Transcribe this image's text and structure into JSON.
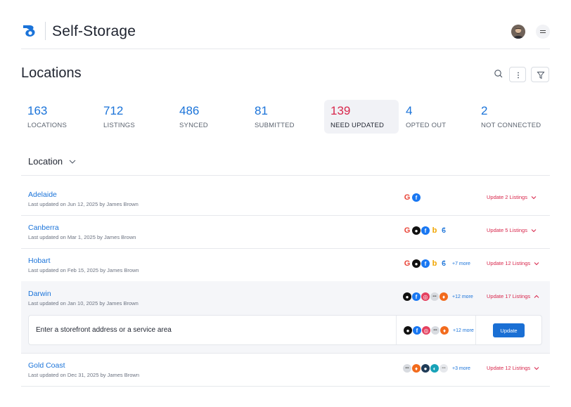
{
  "header": {
    "brand": "Self-Storage"
  },
  "page": {
    "title": "Locations"
  },
  "stats": [
    {
      "value": "163",
      "label": "LOCATIONS"
    },
    {
      "value": "712",
      "label": "LISTINGS"
    },
    {
      "value": "486",
      "label": "SYNCED"
    },
    {
      "value": "81",
      "label": "SUBMITTED"
    },
    {
      "value": "139",
      "label": "NEED UPDATED"
    },
    {
      "value": "4",
      "label": "OPTED OUT"
    },
    {
      "value": "2",
      "label": "NOT CONNECTED"
    }
  ],
  "location_filter": {
    "label": "Location"
  },
  "rows": [
    {
      "name": "Adelaide",
      "meta": "Last updated on Jun 12, 2025 by James Brown",
      "action": "Update 2 Listings"
    },
    {
      "name": "Canberra",
      "meta": "Last updated on Mar 1, 2025 by James Brown",
      "action": "Update 5 Listings"
    },
    {
      "name": "Hobart",
      "meta": "Last updated on Feb 15, 2025 by James Brown",
      "more": "+7 more",
      "action": "Update 12 Listings"
    },
    {
      "name": "Darwin",
      "meta": "Last updated on Jan 10, 2025 by James Brown",
      "more": "+12 more",
      "action": "Update 17 Listings"
    },
    {
      "name": "Gold Coast",
      "meta": "Last updated on Dec 31, 2025 by James Brown",
      "more": "+3 more",
      "action": "Update 12 Listings"
    }
  ],
  "expanded": {
    "prompt": "Enter a storefront address or a service area",
    "more": "+12 more",
    "button": "Update"
  },
  "colors": {
    "accent": "#1a73d9",
    "alert": "#d8264b",
    "button": "#1a6fd4"
  }
}
